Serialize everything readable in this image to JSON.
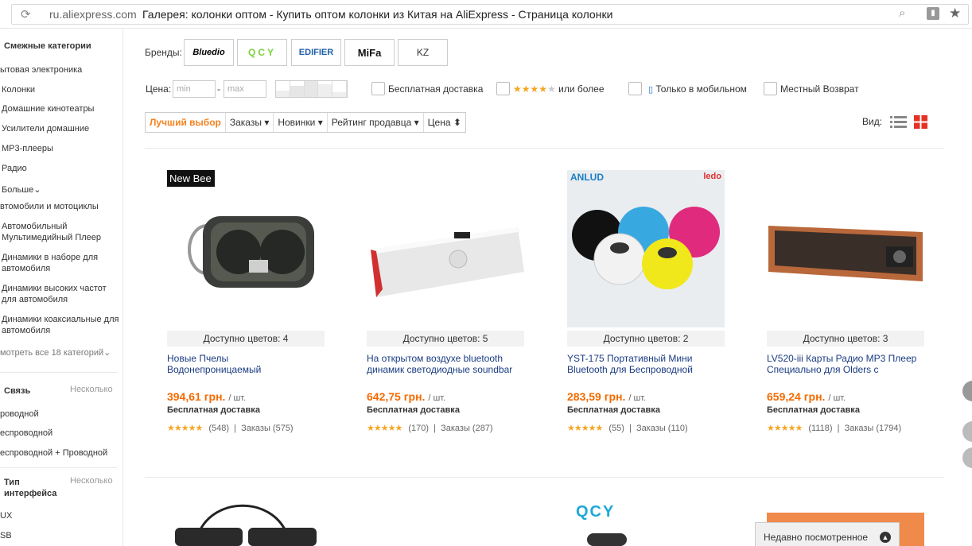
{
  "browser": {
    "domain": "ru.aliexpress.com",
    "title": "Галерея: колонки оптом - Купить оптом колонки из Китая на AliExpress - Страница колонки"
  },
  "sidebar": {
    "related_title": "Смежные категории",
    "categories": [
      "ытовая электроника",
      "Колонки",
      "Домашние кинотеатры",
      "Усилители домашние",
      "MP3-плееры",
      "Радио",
      "Больше",
      "втомобили и мотоциклы",
      "Автомобильный Мультимедийный Плеер",
      "Динамики в наборе для автомобиля",
      "Динамики высоких частот для автомобиля",
      "Динамики коаксиальные для автомобиля"
    ],
    "see_all": "мотреть все 18 категорий",
    "connection": {
      "title": "Связь",
      "more": "Несколько",
      "options": [
        "роводной",
        "еспроводной",
        "еспроводной + Проводной"
      ]
    },
    "interface": {
      "title": "Тип интерфейса",
      "more": "Несколько",
      "options": [
        "UX",
        "SB"
      ]
    }
  },
  "filters": {
    "brands_label": "Бренды:",
    "brands": [
      "Bluedio",
      "QCY",
      "EDIFIER",
      "MiFa",
      "KZ"
    ],
    "price_label": "Цена:",
    "price_min_placeholder": "min",
    "price_max_placeholder": "max",
    "price_dash": "-",
    "free_shipping": "Бесплатная доставка",
    "rating_or_more": "или более",
    "mobile_only": "Только в мобильном",
    "local_return": "Местный Возврат"
  },
  "sort": {
    "best": "Лучший выбор",
    "orders": "Заказы",
    "new": "Новинки",
    "seller_rating": "Рейтинг продавца",
    "price": "Цена",
    "view_label": "Вид:"
  },
  "products": [
    {
      "badge": "New Bee",
      "colors": "Доступно цветов: 4",
      "name": "Новые Пчелы Водонепроницаемый",
      "price": "394,61 грн.",
      "unit": "/ шт.",
      "shipping": "Бесплатная доставка",
      "stars": "★★★★★",
      "reviews": "(548)",
      "orders": "Заказы (575)"
    },
    {
      "badge": "",
      "colors": "Доступно цветов: 5",
      "name": "На открытом воздухе bluetooth динамик светодиодные soundbar",
      "price": "642,75 грн.",
      "unit": "/ шт.",
      "shipping": "Бесплатная доставка",
      "stars": "★★★★★",
      "reviews": "(170)",
      "orders": "Заказы (287)"
    },
    {
      "badge": "ANLUD",
      "colors": "Доступно цветов: 2",
      "name": "YST-175 Портативный Мини Bluetooth для Беспроводной",
      "price": "283,59 грн.",
      "unit": "/ шт.",
      "shipping": "Бесплатная доставка",
      "stars": "★★★★★",
      "reviews": "(55)",
      "orders": "Заказы (110)"
    },
    {
      "badge": "",
      "colors": "Доступно цветов: 3",
      "name": "LV520-iii Карты Радио MP3 Плеер Специально для Olders с",
      "price": "659,24 грн.",
      "unit": "/ шт.",
      "shipping": "Бесплатная доставка",
      "stars": "★★★★★",
      "reviews": "(1118)",
      "orders": "Заказы (1794)"
    }
  ],
  "extra": {
    "brand2_logo": "ledo",
    "row2_logo": "QCY"
  },
  "recently_viewed": "Недавно посмотренное",
  "colors": {
    "accent": "#f56a00",
    "link": "#1a3b82",
    "star": "#f5a623"
  }
}
